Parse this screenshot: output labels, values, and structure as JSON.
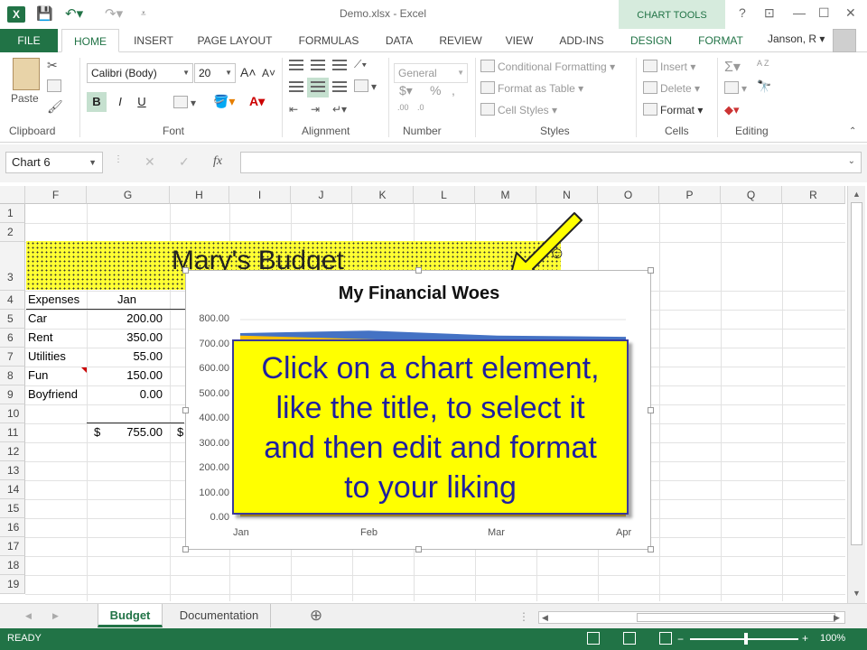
{
  "window": {
    "title": "Demo.xlsx - Excel",
    "context_tab": "CHART TOOLS",
    "user": "Janson, R",
    "app_icon": "excel-icon",
    "controls": [
      "?",
      "⊡",
      "—",
      "☐",
      "✕"
    ]
  },
  "quick_access": {
    "save_icon": "save-icon",
    "undo_icon": "undo-icon",
    "redo_icon": "redo-icon",
    "customize_icon": "customize-icon"
  },
  "tabs": [
    "FILE",
    "HOME",
    "INSERT",
    "PAGE LAYOUT",
    "FORMULAS",
    "DATA",
    "REVIEW",
    "VIEW",
    "ADD-INS",
    "DESIGN",
    "FORMAT"
  ],
  "ribbon": {
    "clipboard": {
      "paste": "Paste",
      "label": "Clipboard"
    },
    "font": {
      "name": "Calibri (Body)",
      "size": "20",
      "bold": "B",
      "italic": "I",
      "underline": "U",
      "grow": "A",
      "shrink": "A",
      "label": "Font"
    },
    "alignment": {
      "label": "Alignment"
    },
    "number": {
      "format": "General",
      "currency": "$",
      "percent": "%",
      "comma": ",",
      "inc_dec": ".00",
      "dec_dec": ".0",
      "label": "Number"
    },
    "styles": {
      "conditional": "Conditional Formatting",
      "table": "Format as Table",
      "cell_styles": "Cell Styles",
      "label": "Styles"
    },
    "cells": {
      "insert": "Insert",
      "delete": "Delete",
      "format": "Format",
      "label": "Cells"
    },
    "editing": {
      "sum": "Σ",
      "sort": "A Z",
      "find": "🔭",
      "label": "Editing"
    }
  },
  "formula_bar": {
    "name_box": "Chart 6",
    "cancel": "✕",
    "enter": "✓",
    "fx": "fx",
    "value": ""
  },
  "columns": [
    "F",
    "G",
    "H",
    "I",
    "J",
    "K",
    "L",
    "M",
    "N",
    "O",
    "P",
    "Q",
    "R"
  ],
  "rows": [
    "1",
    "2",
    "3",
    "4",
    "5",
    "6",
    "7",
    "8",
    "9",
    "10",
    "11",
    "12",
    "13",
    "14",
    "15",
    "16",
    "17",
    "18",
    "19"
  ],
  "sheet": {
    "banner_title": "Mary's Budget",
    "header": {
      "label": "Expenses",
      "col": "Jan"
    },
    "items": [
      {
        "label": "Car",
        "value": "200.00"
      },
      {
        "label": "Rent",
        "value": "350.00"
      },
      {
        "label": "Utilities",
        "value": "55.00"
      },
      {
        "label": "Fun",
        "value": "150.00"
      },
      {
        "label": "Boyfriend",
        "value": "0.00"
      }
    ],
    "total_symbol": "$",
    "total_value": "755.00",
    "total_symbol_h": "$"
  },
  "chart_data": {
    "type": "area",
    "title": "My Financial Woes",
    "x": [
      "Jan",
      "Feb",
      "Mar",
      "Apr"
    ],
    "y_ticks": [
      "800.00",
      "700.00",
      "600.00",
      "500.00",
      "400.00",
      "300.00",
      "200.00",
      "100.00",
      "0.00"
    ],
    "ylim": [
      0,
      800
    ],
    "series": [
      {
        "values": [
          745,
          755,
          735,
          730
        ],
        "color": "#4472c4"
      },
      {
        "values": [
          735,
          720,
          705,
          700
        ],
        "color": "#ffc000"
      }
    ]
  },
  "callout": {
    "text_lines": [
      "Click on a chart element,",
      "like the title, to select it",
      "and then edit and format",
      "to your liking"
    ]
  },
  "sheet_tabs": [
    "Budget",
    "Documentation"
  ],
  "add_sheet": "⊕",
  "status": {
    "text": "READY",
    "zoom": "100%"
  }
}
